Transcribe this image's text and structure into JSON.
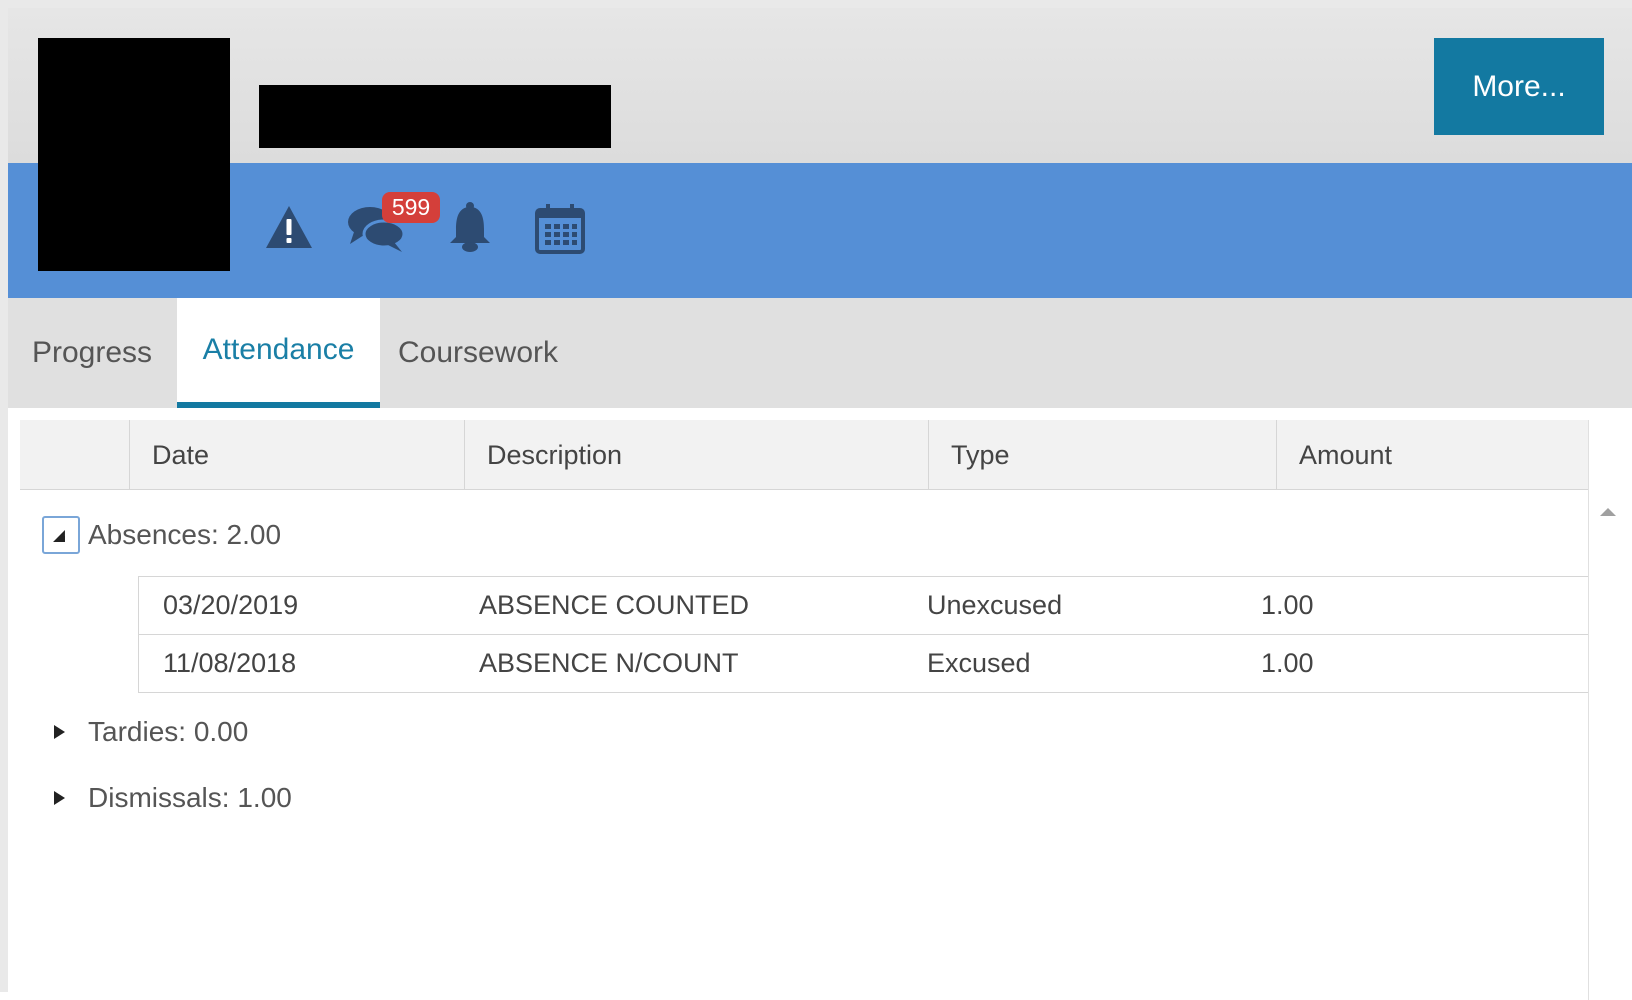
{
  "header": {
    "more_button_label": "More...",
    "icons": [
      "warning-icon",
      "messages-icon",
      "bell-icon",
      "calendar-icon"
    ],
    "messages_badge_count": "599",
    "colors": {
      "band": "#558fd6",
      "more_button": "#1379a1",
      "badge": "#d43f3a"
    }
  },
  "tabs": [
    {
      "label": "Progress",
      "active": false
    },
    {
      "label": "Attendance",
      "active": true
    },
    {
      "label": "Coursework",
      "active": false
    }
  ],
  "grid": {
    "columns": [
      "Date",
      "Description",
      "Type",
      "Amount"
    ],
    "groups": [
      {
        "label": "Absences: 2.00",
        "expanded": true,
        "rows": [
          {
            "date": "03/20/2019",
            "description": "ABSENCE COUNTED",
            "type": "Unexcused",
            "amount": "1.00"
          },
          {
            "date": "11/08/2018",
            "description": "ABSENCE N/COUNT",
            "type": "Excused",
            "amount": "1.00"
          }
        ]
      },
      {
        "label": "Tardies: 0.00",
        "expanded": false,
        "rows": []
      },
      {
        "label": "Dismissals: 1.00",
        "expanded": false,
        "rows": []
      }
    ]
  }
}
